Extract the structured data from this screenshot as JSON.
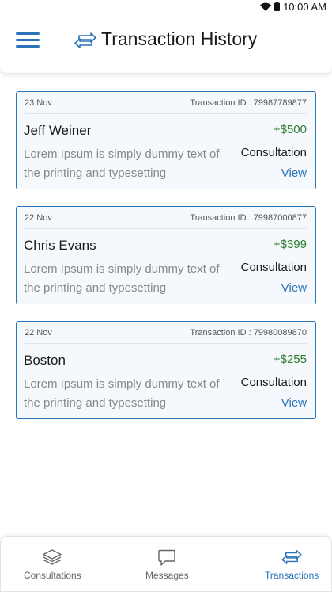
{
  "status_bar": {
    "time": "10:00 AM",
    "icons": [
      "wifi-icon",
      "battery-icon"
    ]
  },
  "header": {
    "title": "Transaction History",
    "menu_icon": "hamburger-menu-icon",
    "title_icon": "transfer-arrows-icon"
  },
  "colors": {
    "accent": "#2a74b8",
    "amount": "#2e7d32",
    "card_bg": "#f5f9fd",
    "muted_text": "#888888"
  },
  "transactions": [
    {
      "date": "23 Nov",
      "transaction_id": "Transaction ID : 79987789877",
      "name": "Jeff Weiner",
      "amount": "+$500",
      "description": "Lorem Ipsum is simply dummy text of the printing and typesetting",
      "service": "Consultation",
      "view_label": "View"
    },
    {
      "date": "22 Nov",
      "transaction_id": "Transaction ID : 79987000877",
      "name": "Chris Evans",
      "amount": "+$399",
      "description": "Lorem Ipsum is simply dummy text of the printing and typesetting",
      "service": "Consultation",
      "view_label": "View"
    },
    {
      "date": "22 Nov",
      "transaction_id": "Transaction ID : 79980089870",
      "name": "Boston",
      "amount": "+$255",
      "description": "Lorem Ipsum is simply dummy text of the printing and typesetting",
      "service": "Consultation",
      "view_label": "View"
    }
  ],
  "bottom_nav": {
    "items": [
      {
        "label": "Consultations",
        "icon": "layers-icon",
        "active": false
      },
      {
        "label": "Messages",
        "icon": "message-bubble-icon",
        "active": false
      },
      {
        "label": "Transactions",
        "icon": "transfer-arrows-icon",
        "active": true
      }
    ]
  }
}
